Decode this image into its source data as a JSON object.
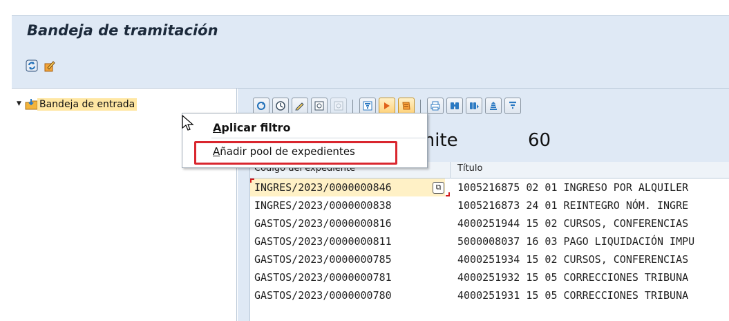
{
  "window": {
    "title": "Bandeja de tramitación"
  },
  "app_toolbar": {
    "icons": [
      "refresh-icon",
      "edit-pencil-icon"
    ]
  },
  "tree": {
    "root_label": "Bandeja de entrada"
  },
  "alv_toolbar": {
    "icons": [
      "refresh-icon",
      "clock-icon",
      "pencil-icon",
      "view-icon",
      "view-disabled-icon",
      "filter-icon",
      "play-orange-icon",
      "orange-sheet-icon",
      "print-icon",
      "find-icon",
      "find-next-icon",
      "sort-icon",
      "filter-set-icon"
    ]
  },
  "summary": {
    "label_visible": "ámite",
    "count": "60"
  },
  "grid": {
    "columns": [
      "Código del expediente",
      "Título"
    ],
    "rows": [
      {
        "code": "INGRES/2023/0000000846",
        "title": "1005216875 02 01 INGRESO POR ALQUILER",
        "selected": true
      },
      {
        "code": "INGRES/2023/0000000838",
        "title": "1005216873 24 01 REINTEGRO NÓM. INGRE"
      },
      {
        "code": "GASTOS/2023/0000000816",
        "title": "4000251944 15 02 CURSOS, CONFERENCIAS"
      },
      {
        "code": "GASTOS/2023/0000000811",
        "title": "5000008037 16 03 PAGO LIQUIDACIÓN IMPU"
      },
      {
        "code": "GASTOS/2023/0000000785",
        "title": "4000251934 15 02 CURSOS, CONFERENCIAS"
      },
      {
        "code": "GASTOS/2023/0000000781",
        "title": "4000251932 15 05 CORRECCIONES TRIBUNA"
      },
      {
        "code": "GASTOS/2023/0000000780",
        "title": "4000251931 15 05 CORRECCIONES TRIBUNA"
      }
    ]
  },
  "context_menu": {
    "item1_prefix": "A",
    "item1_rest": "plicar filtro",
    "item2_prefix": "A",
    "item2_rest": "ñadir pool de expedientes"
  },
  "colors": {
    "highlight_border": "#d9262e",
    "selection": "#ffe7a3",
    "panel": "#dfe9f5"
  }
}
